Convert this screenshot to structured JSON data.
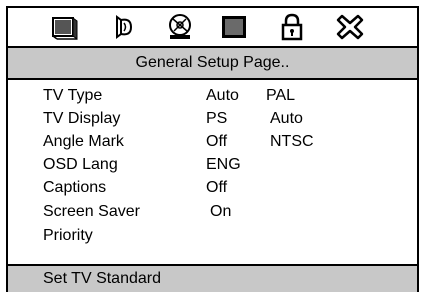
{
  "icons": [
    "tv-setup-icon",
    "audio-setup-icon",
    "video-disc-icon",
    "preference-screen-icon",
    "password-lock-icon",
    "exit-icon"
  ],
  "header": {
    "title": "General Setup Page.."
  },
  "settings": [
    {
      "label": "TV Type",
      "value": "Auto",
      "option": "PAL"
    },
    {
      "label": "TV Display",
      "value": "PS",
      "option": "Auto"
    },
    {
      "label": "Angle Mark",
      "value": "Off",
      "option": "NTSC"
    },
    {
      "label": "OSD Lang",
      "value": "ENG",
      "option": ""
    },
    {
      "label": "Captions",
      "value": "Off",
      "option": ""
    },
    {
      "label": "Screen Saver",
      "value": "On",
      "option": ""
    },
    {
      "label": "Priority",
      "value": "",
      "option": ""
    }
  ],
  "status": {
    "text": "Set TV Standard"
  }
}
